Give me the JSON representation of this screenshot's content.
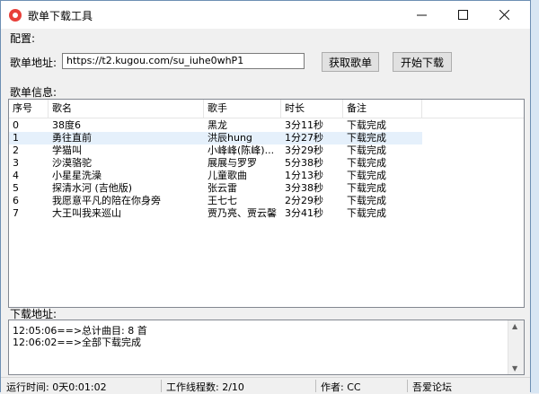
{
  "window": {
    "title": "歌单下载工具"
  },
  "config_label": "配置:",
  "playlist_url": {
    "label": "歌单地址:",
    "value": "https://t2.kugou.com/su_iuhe0whP1"
  },
  "buttons": {
    "fetch": "获取歌单",
    "start": "开始下载"
  },
  "info_label": "歌单信息:",
  "table": {
    "headers": [
      "序号",
      "歌名",
      "歌手",
      "时长",
      "备注"
    ],
    "rows": [
      [
        "0",
        "38度6",
        "黑龙",
        "3分11秒",
        "下载完成"
      ],
      [
        "1",
        "勇往直前",
        "洪辰hung",
        "1分27秒",
        "下载完成"
      ],
      [
        "2",
        "学猫叫",
        "小峰峰(陈峰)...",
        "3分29秒",
        "下载完成"
      ],
      [
        "3",
        "沙漠骆驼",
        "展展与罗罗",
        "5分38秒",
        "下载完成"
      ],
      [
        "4",
        "小星星洗澡",
        "儿童歌曲",
        "1分13秒",
        "下载完成"
      ],
      [
        "5",
        "探清水河 (吉他版)",
        "张云雷",
        "3分38秒",
        "下载完成"
      ],
      [
        "6",
        "我愿意平凡的陪在你身旁",
        "王七七",
        "2分29秒",
        "下载完成"
      ],
      [
        "7",
        "大王叫我来巡山",
        "贾乃亮、贾云馨",
        "3分41秒",
        "下载完成"
      ]
    ],
    "selected_row": 1
  },
  "download_label": "下载地址:",
  "log": [
    "12:05:06==>总计曲目: 8 首",
    "12:06:02==>全部下载完成"
  ],
  "status": {
    "runtime": "运行时间: 0天0:01:02",
    "threads": "工作线程数: 2/10",
    "author": "作者: CC",
    "forum": "吾爱论坛"
  }
}
